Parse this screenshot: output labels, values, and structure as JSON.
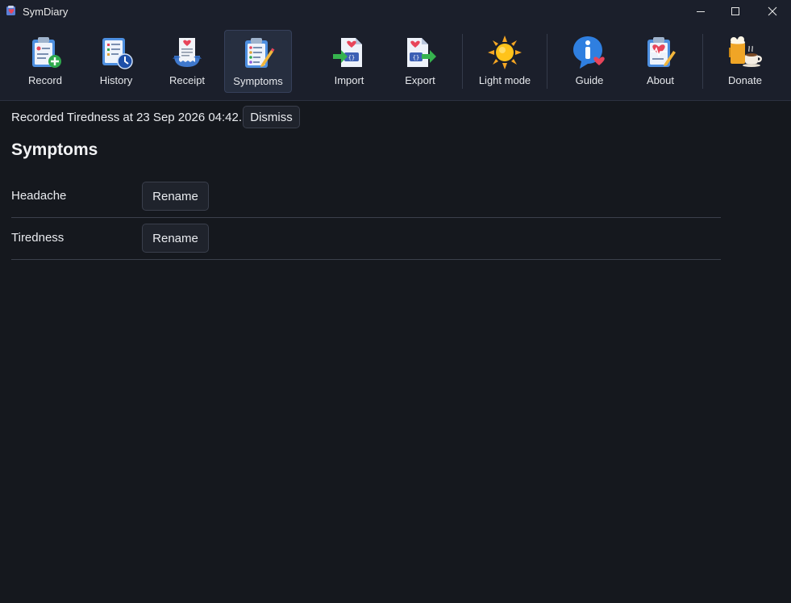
{
  "window": {
    "title": "SymDiary"
  },
  "toolbar": {
    "items": [
      {
        "id": "record",
        "label": "Record",
        "icon": "record-clipboard-icon"
      },
      {
        "id": "history",
        "label": "History",
        "icon": "history-clock-icon"
      },
      {
        "id": "receipt",
        "label": "Receipt",
        "icon": "receipt-icon"
      },
      {
        "id": "symptoms",
        "label": "Symptoms",
        "icon": "symptoms-clipboard-icon",
        "active": true
      },
      {
        "id": "import",
        "label": "Import",
        "icon": "import-icon"
      },
      {
        "id": "export",
        "label": "Export",
        "icon": "export-icon"
      },
      {
        "id": "lightmode",
        "label": "Light mode",
        "icon": "sun-icon"
      },
      {
        "id": "guide",
        "label": "Guide",
        "icon": "info-icon"
      },
      {
        "id": "about",
        "label": "About",
        "icon": "about-clipboard-icon"
      },
      {
        "id": "donate",
        "label": "Donate",
        "icon": "beer-coffee-icon"
      }
    ]
  },
  "notice": {
    "text": "Recorded Tiredness at 23 Sep 2026 04:42.",
    "dismiss_label": "Dismiss"
  },
  "page": {
    "title": "Symptoms"
  },
  "symptoms": [
    {
      "name": "Headache",
      "rename_label": "Rename"
    },
    {
      "name": "Tiredness",
      "rename_label": "Rename"
    }
  ],
  "colors": {
    "background": "#15181e",
    "toolbar": "#1b1f2b",
    "active_tab": "#262e3f"
  }
}
